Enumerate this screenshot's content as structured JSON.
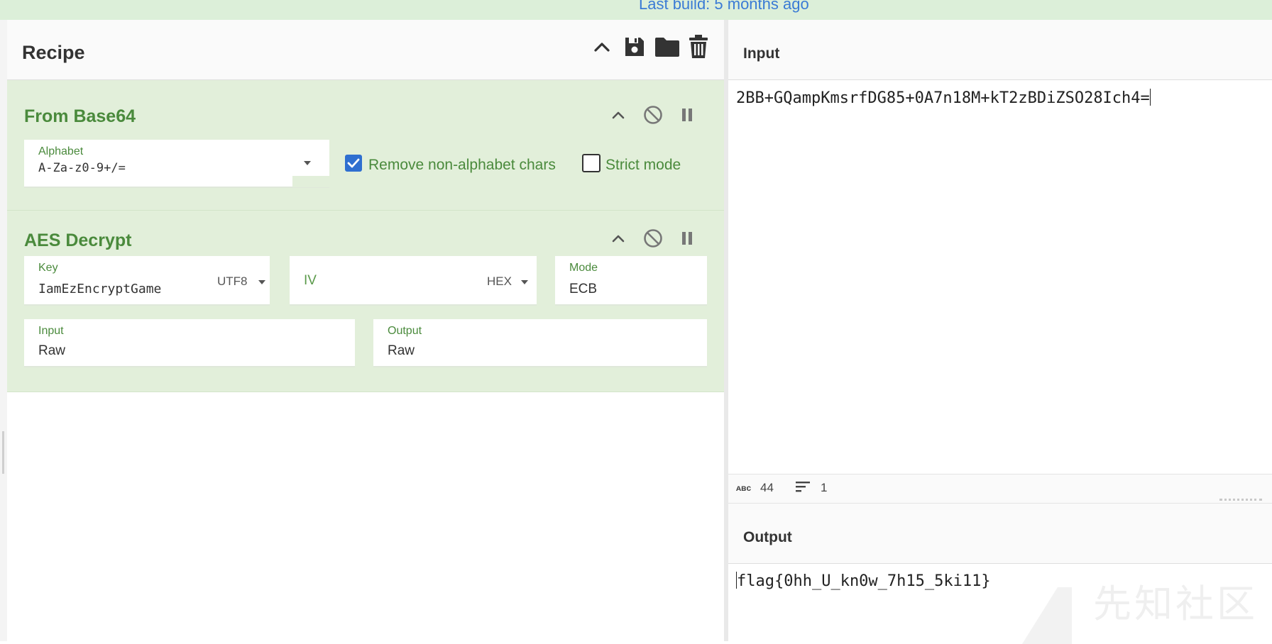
{
  "topbar": {
    "build_text": "Last build: 5 months ago"
  },
  "recipe": {
    "title": "Recipe",
    "header_icons": [
      "chevron-up-icon",
      "save-icon",
      "folder-icon",
      "trash-icon"
    ],
    "operations": [
      {
        "title": "From Base64",
        "alphabet_label": "Alphabet",
        "alphabet_value": "A-Za-z0-9+/=",
        "remove_label": "Remove non-alphabet chars",
        "remove_checked": true,
        "strict_label": "Strict mode",
        "strict_checked": false
      },
      {
        "title": "AES Decrypt",
        "key_label": "Key",
        "key_value": "IamEzEncryptGame",
        "key_encoding": "UTF8",
        "iv_placeholder": "IV",
        "iv_encoding": "HEX",
        "mode_label": "Mode",
        "mode_value": "ECB",
        "input_label": "Input",
        "input_value": "Raw",
        "output_label": "Output",
        "output_value": "Raw"
      }
    ]
  },
  "input": {
    "title": "Input",
    "text": "2BB+GQampKmsrfDG85+0A7n18M+kT2zBDiZSO28Ich4=",
    "stats": {
      "length_icon": "abc-icon",
      "length": "44",
      "lines_icon": "lines-icon",
      "lines": "1"
    }
  },
  "output": {
    "title": "Output",
    "text": "flag{0hh_U_kn0w_7h15_5ki11}"
  },
  "watermark": "先知社区",
  "colors": {
    "accent_green": "#4a8a3c",
    "op_bg": "#e2efda",
    "link_blue": "#3a7bd5",
    "check_blue": "#2f6fd0"
  }
}
